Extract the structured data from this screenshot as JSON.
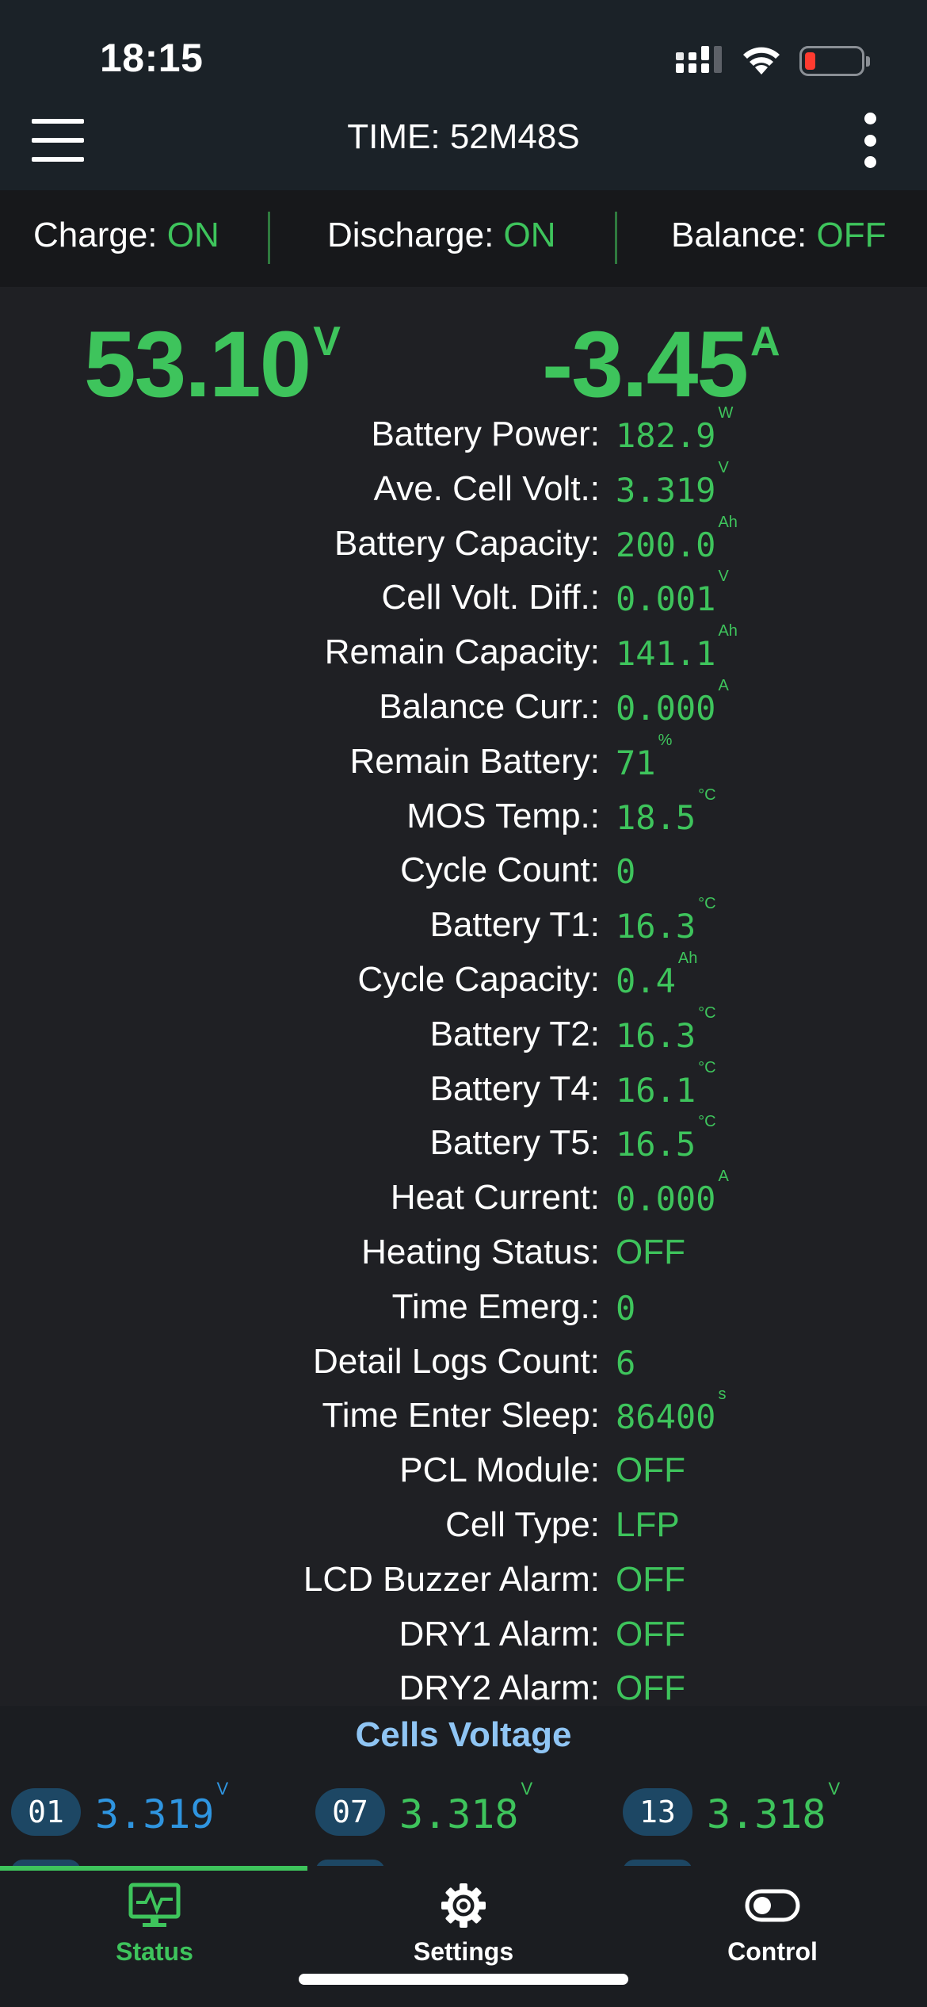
{
  "status_bar": {
    "time": "18:15"
  },
  "header": {
    "title": "TIME: 52M48S"
  },
  "switches": [
    {
      "label": "Charge:",
      "value": "ON"
    },
    {
      "label": "Discharge:",
      "value": "ON"
    },
    {
      "label": "Balance:",
      "value": "OFF"
    }
  ],
  "main": {
    "voltage": {
      "value": "53.10",
      "unit": "V"
    },
    "current": {
      "value": "-3.45",
      "unit": "A"
    }
  },
  "details": [
    {
      "label": "Battery Power:",
      "value": "182.9",
      "unit": "W"
    },
    {
      "label": "Ave. Cell Volt.:",
      "value": "3.319",
      "unit": "V"
    },
    {
      "label": "Battery Capacity:",
      "value": "200.0",
      "unit": "Ah"
    },
    {
      "label": "Cell Volt. Diff.:",
      "value": "0.001",
      "unit": "V"
    },
    {
      "label": "Remain Capacity:",
      "value": "141.1",
      "unit": "Ah"
    },
    {
      "label": "Balance Curr.:",
      "value": "0.000",
      "unit": "A"
    },
    {
      "label": "Remain Battery:",
      "value": "71",
      "unit": "%"
    },
    {
      "label": "MOS Temp.:",
      "value": "18.5",
      "unit": "°C"
    },
    {
      "label": "Cycle Count:",
      "value": "0",
      "unit": ""
    },
    {
      "label": "Battery T1:",
      "value": "16.3",
      "unit": "°C"
    },
    {
      "label": "Cycle Capacity:",
      "value": "0.4",
      "unit": "Ah"
    },
    {
      "label": "Battery T2:",
      "value": "16.3",
      "unit": "°C"
    },
    {
      "label": "Battery T4:",
      "value": "16.1",
      "unit": "°C"
    },
    {
      "label": "Battery T5:",
      "value": "16.5",
      "unit": "°C"
    },
    {
      "label": "Heat Current:",
      "value": "0.000",
      "unit": "A"
    },
    {
      "label": "Heating Status:",
      "value": "OFF",
      "unit": ""
    },
    {
      "label": "Time Emerg.:",
      "value": "0",
      "unit": ""
    },
    {
      "label": "Detail Logs Count:",
      "value": "6",
      "unit": ""
    },
    {
      "label": "Time Enter Sleep:",
      "value": "86400",
      "unit": "s"
    },
    {
      "label": "PCL Module:",
      "value": "OFF",
      "unit": ""
    },
    {
      "label": "Cell Type:",
      "value": "LFP",
      "unit": ""
    },
    {
      "label": "LCD Buzzer Alarm:",
      "value": "OFF",
      "unit": ""
    },
    {
      "label": "DRY1 Alarm:",
      "value": "OFF",
      "unit": ""
    },
    {
      "label": "DRY2 Alarm:",
      "value": "OFF",
      "unit": ""
    }
  ],
  "cells": {
    "title": "Cells Voltage",
    "items": [
      {
        "num": "01",
        "value": "3.319",
        "unit": "V",
        "color": "#2f95e0"
      },
      {
        "num": "07",
        "value": "3.318",
        "unit": "V",
        "color": "#3ec45c"
      },
      {
        "num": "13",
        "value": "3.318",
        "unit": "V",
        "color": "#3ec45c"
      }
    ]
  },
  "tabs": [
    {
      "label": "Status",
      "icon": "monitor-pulse-icon",
      "active": true
    },
    {
      "label": "Settings",
      "icon": "gear-icon",
      "active": false
    },
    {
      "label": "Control",
      "icon": "toggle-icon",
      "active": false
    }
  ],
  "colors": {
    "accent_green": "#3ec45c",
    "cell_blue": "#2f95e0",
    "title_blue": "#8fc5f4"
  }
}
